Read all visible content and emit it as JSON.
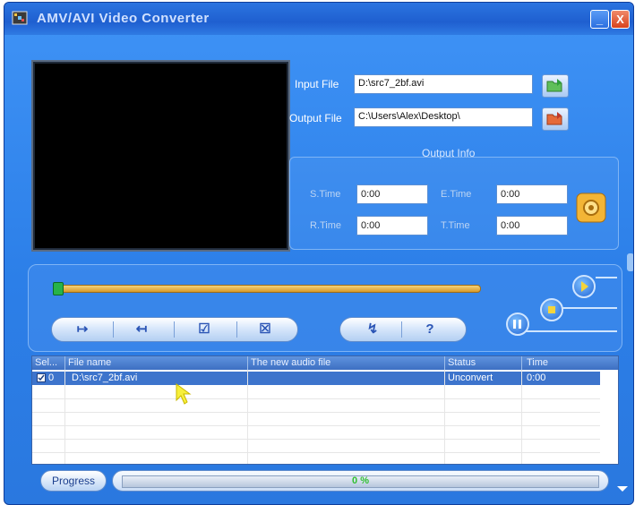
{
  "window": {
    "title": "AMV/AVI Video Converter",
    "minimize_glyph": "_",
    "close_glyph": "X"
  },
  "files": {
    "input_label": "Input File",
    "input_value": "D:\\src7_2bf.avi",
    "output_label": "Output File",
    "output_value": "C:\\Users\\Alex\\Desktop\\"
  },
  "output_info": {
    "title": "Output Info",
    "s_time_label": "S.Time",
    "s_time_value": "0:00",
    "e_time_label": "E.Time",
    "e_time_value": "0:00",
    "r_time_label": "R.Time",
    "r_time_value": "0:00",
    "t_time_label": "T.Time",
    "t_time_value": "0:00"
  },
  "controls": {
    "set_start_glyph": "↦",
    "set_end_glyph": "↤",
    "select_all_glyph": "☑",
    "clear_glyph": "☒",
    "convert_glyph": "↯",
    "help_glyph": "?",
    "seek_position": 0.0
  },
  "table": {
    "columns": [
      "Sel...",
      "File name",
      "The new audio file",
      "Status",
      "Time"
    ],
    "rows": [
      {
        "sel": "0",
        "file_name": "D:\\src7_2bf.avi",
        "new_audio_file": "",
        "status": "Unconvert",
        "time": "0:00"
      }
    ]
  },
  "progress": {
    "button_label": "Progress",
    "value_text": "0 %",
    "value": 0.0
  },
  "colors": {
    "window_blue": "#3f93f6",
    "title_blue": "#1f5fd0",
    "accent_orange": "#d89a2a",
    "progress_green": "#2fbf2f"
  },
  "icons": {
    "app": "film-strip-icon",
    "input_browse": "folder-open-icon",
    "output_browse": "folder-export-icon",
    "convert": "gear-convert-icon",
    "play": "play-icon",
    "stop": "stop-icon",
    "pause": "pause-icon"
  }
}
